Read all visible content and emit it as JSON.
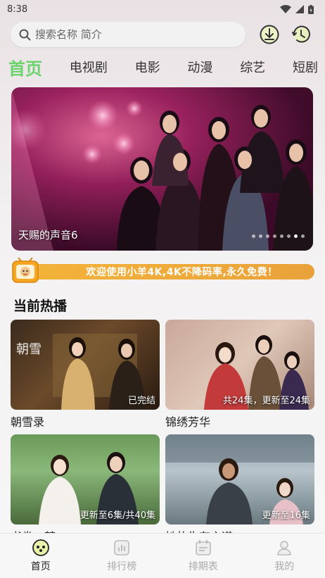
{
  "status": {
    "time": "8:38"
  },
  "search": {
    "placeholder": "搜索名称 简介"
  },
  "tabs": [
    {
      "label": "首页",
      "active": true
    },
    {
      "label": "电视剧"
    },
    {
      "label": "电影"
    },
    {
      "label": "动漫"
    },
    {
      "label": "综艺"
    },
    {
      "label": "短剧"
    }
  ],
  "banner": {
    "caption": "天赐的声音6",
    "slides": 8,
    "active_slide": 7
  },
  "notice": {
    "text": "欢迎使用小羊4K,4K不降码率,永久免费！"
  },
  "section": {
    "title": "当前热播"
  },
  "cards": [
    {
      "title": "朝雪录",
      "badge": "已完结"
    },
    {
      "title": "锦绣芳华",
      "badge": "共24集，更新至24集"
    },
    {
      "title": "书卷一梦",
      "badge": "更新至6集/共40集"
    },
    {
      "title": "她的生存之道",
      "badge": "更新至16集"
    }
  ],
  "nav": [
    {
      "label": "首页",
      "icon": "home-icon",
      "active": true
    },
    {
      "label": "排行榜",
      "icon": "chart-icon"
    },
    {
      "label": "排期表",
      "icon": "calendar-icon"
    },
    {
      "label": "我的",
      "icon": "user-icon"
    }
  ],
  "colors": {
    "accent": "#6bd36b",
    "notice": "#f0ad3a"
  }
}
